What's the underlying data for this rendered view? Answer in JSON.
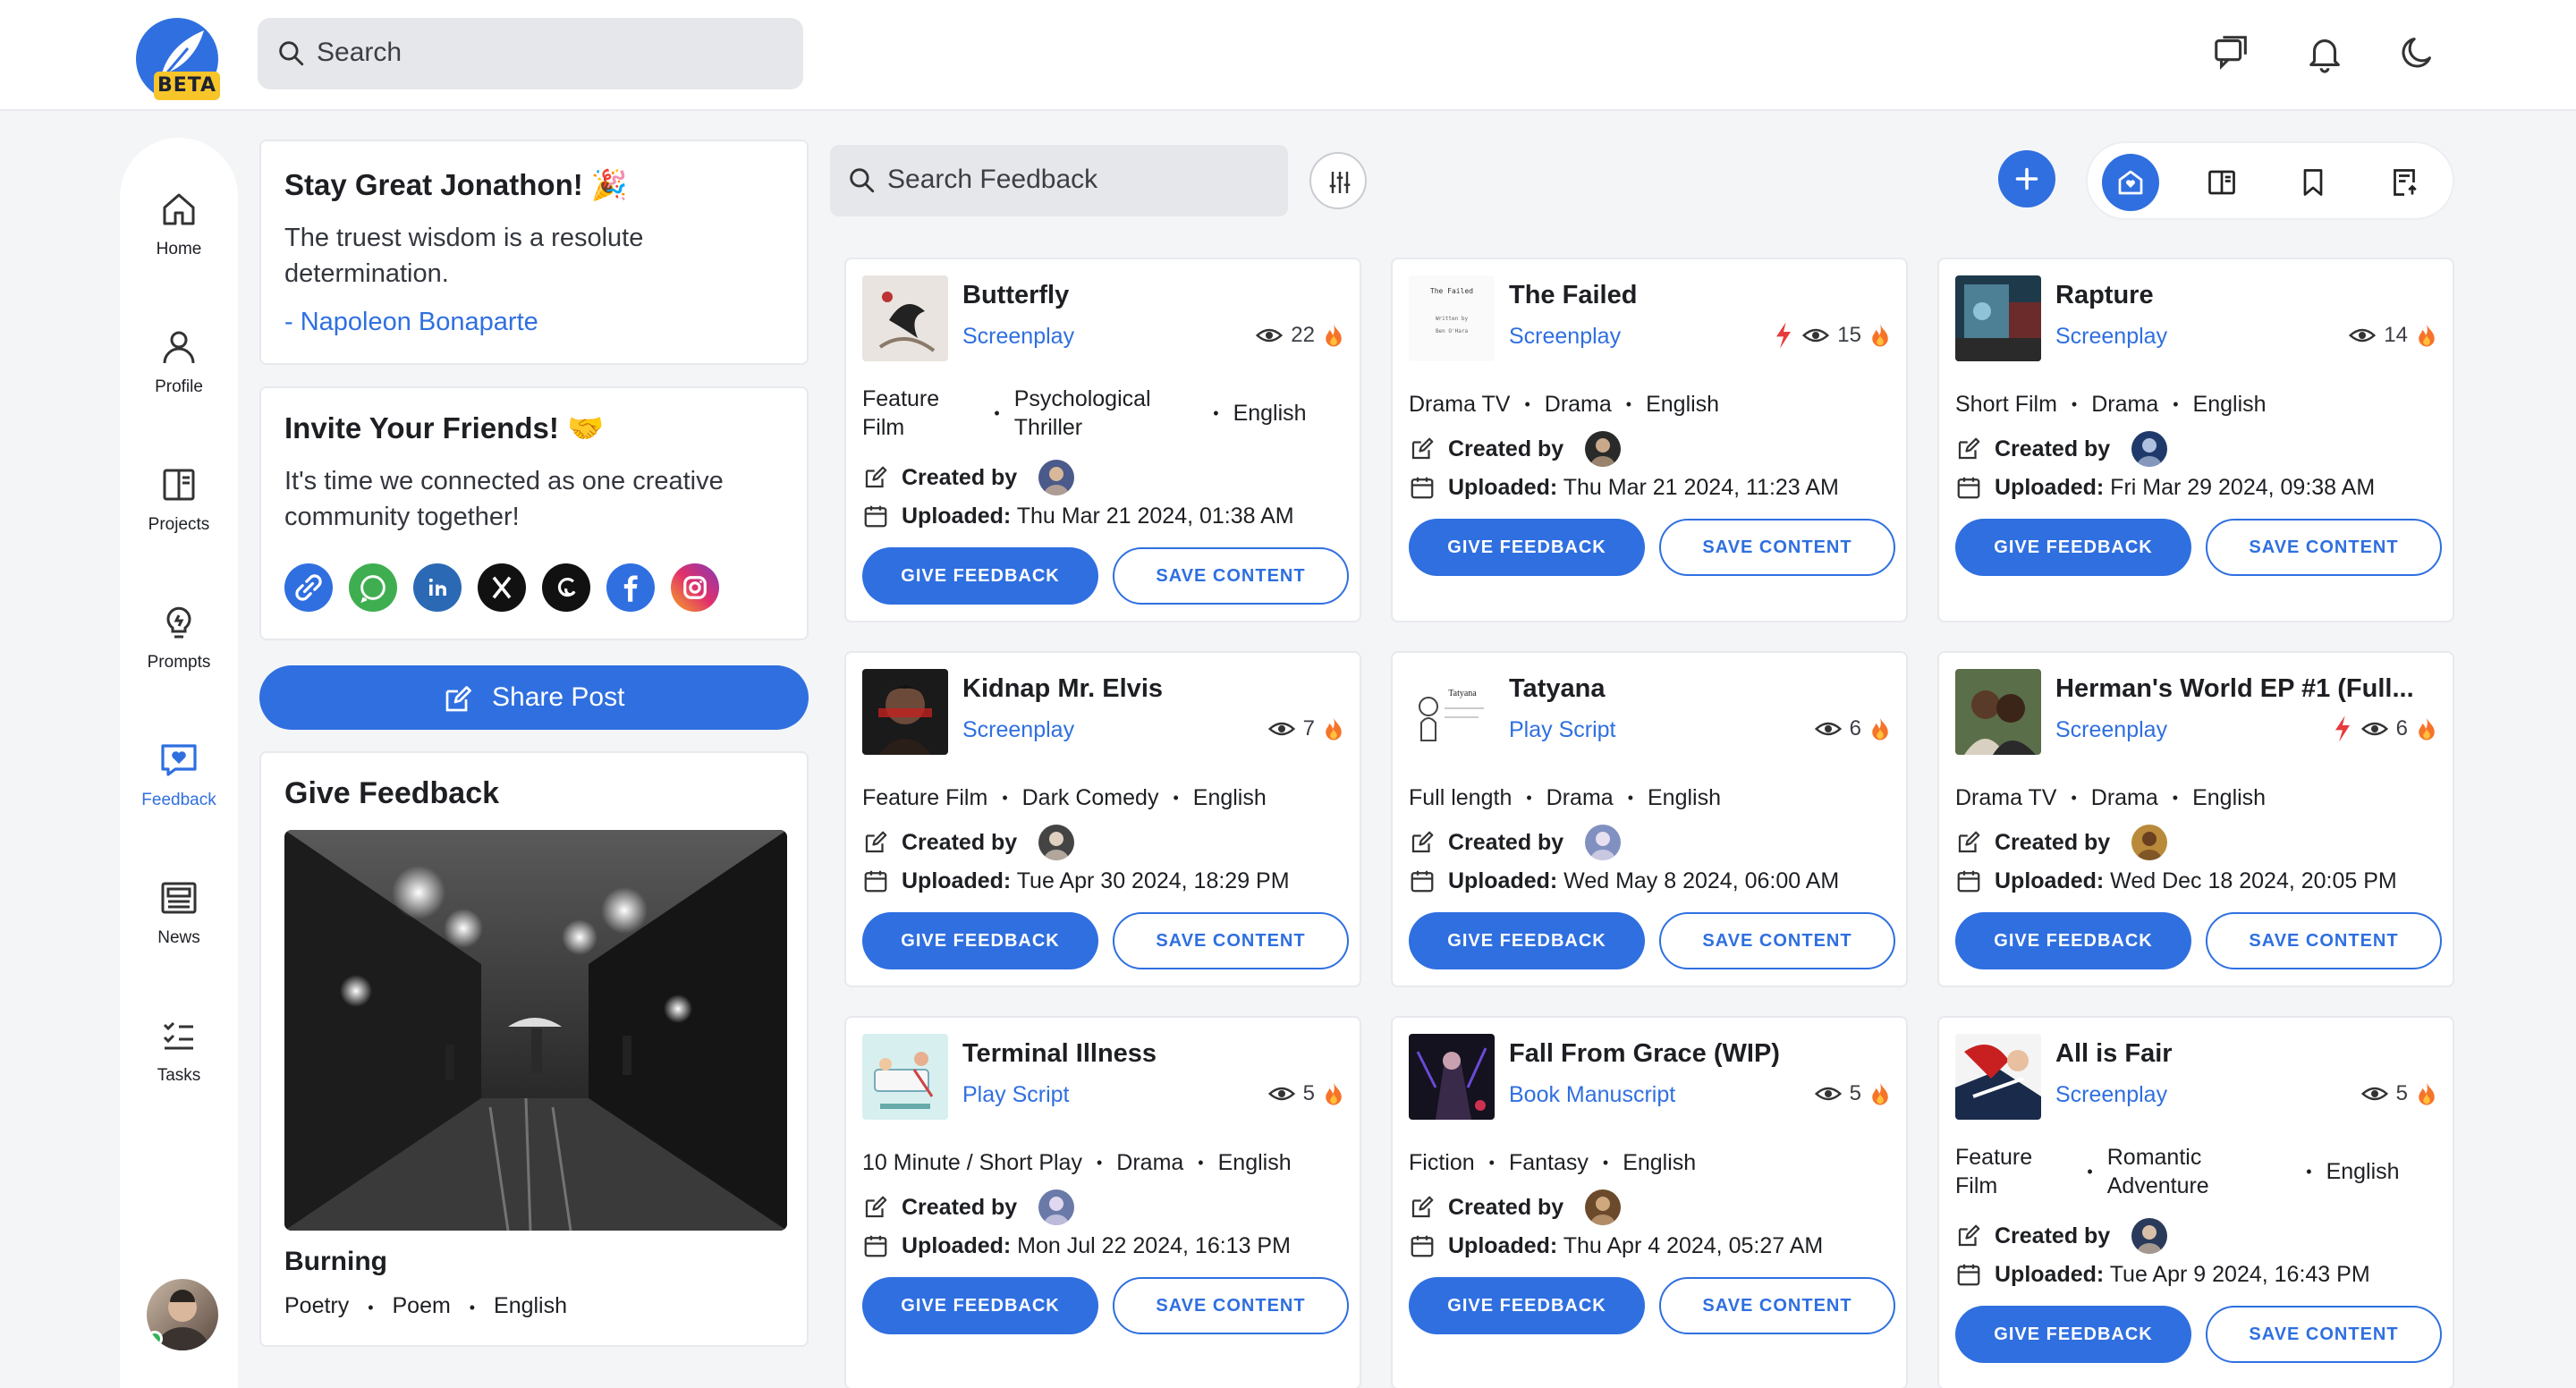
{
  "app": {
    "logo_badge": "BETA",
    "accent": "#2f6fe0"
  },
  "topbar": {
    "search_placeholder": "Search"
  },
  "nav": [
    {
      "label": "Home",
      "icon": "home-icon"
    },
    {
      "label": "Profile",
      "icon": "user-icon"
    },
    {
      "label": "Projects",
      "icon": "book-icon"
    },
    {
      "label": "Prompts",
      "icon": "lightbulb-icon"
    },
    {
      "label": "Feedback",
      "icon": "feedback-icon",
      "active": true
    },
    {
      "label": "News",
      "icon": "newspaper-icon"
    },
    {
      "label": "Tasks",
      "icon": "tasks-icon"
    }
  ],
  "greeting": {
    "title": "Stay Great Jonathon! 🎉",
    "quote": "The truest wisdom is a resolute determination.",
    "author": "- Napoleon Bonaparte"
  },
  "invite": {
    "title": "Invite Your Friends! 🤝",
    "text": "It's time we connected as one creative community together!",
    "socials": [
      "link",
      "whatsapp",
      "linkedin",
      "x",
      "threads",
      "facebook",
      "instagram"
    ]
  },
  "share_button": "Share Post",
  "give_feedback": {
    "title": "Give Feedback",
    "item_title": "Burning",
    "tags": [
      "Poetry",
      "Poem",
      "English"
    ]
  },
  "feedback_search": {
    "placeholder": "Search Feedback"
  },
  "labels": {
    "created_by": "Created by",
    "uploaded": "Uploaded:",
    "give_feedback": "GIVE FEEDBACK",
    "save_content": "SAVE CONTENT"
  },
  "cards": [
    {
      "title": "Butterfly",
      "type": "Screenplay",
      "views": "22",
      "hot": false,
      "tags": [
        "Feature Film",
        "Psychological Thriller",
        "English"
      ],
      "uploaded": "Thu Mar 21 2024, 01:38 AM"
    },
    {
      "title": "The Failed",
      "type": "Screenplay",
      "views": "15",
      "hot": true,
      "tags": [
        "Drama TV",
        "Drama",
        "English"
      ],
      "uploaded": "Thu Mar 21 2024, 11:23 AM",
      "thumb_lines": [
        "The Failed",
        "Written by",
        "Ben O'Hara"
      ]
    },
    {
      "title": "Rapture",
      "type": "Screenplay",
      "views": "14",
      "hot": false,
      "tags": [
        "Short Film",
        "Drama",
        "English"
      ],
      "uploaded": "Fri Mar 29 2024, 09:38 AM"
    },
    {
      "title": "Kidnap Mr. Elvis",
      "type": "Screenplay",
      "views": "7",
      "hot": false,
      "tags": [
        "Feature Film",
        "Dark Comedy",
        "English"
      ],
      "uploaded": "Tue Apr 30 2024, 18:29 PM"
    },
    {
      "title": "Tatyana",
      "type": "Play Script",
      "views": "6",
      "hot": false,
      "tags": [
        "Full length",
        "Drama",
        "English"
      ],
      "uploaded": "Wed May 8 2024, 06:00 AM",
      "thumb_lines": [
        "Tatyana"
      ]
    },
    {
      "title": "Herman's World EP #1 (Full...",
      "type": "Screenplay",
      "views": "6",
      "hot": true,
      "tags": [
        "Drama TV",
        "Drama",
        "English"
      ],
      "uploaded": "Wed Dec 18 2024, 20:05 PM"
    },
    {
      "title": "Terminal Illness",
      "type": "Play Script",
      "views": "5",
      "hot": false,
      "tags": [
        "10 Minute / Short Play",
        "Drama",
        "English"
      ],
      "uploaded": "Mon Jul 22 2024, 16:13 PM"
    },
    {
      "title": "Fall From Grace (WIP)",
      "type": "Book Manuscript",
      "views": "5",
      "hot": false,
      "tags": [
        "Fiction",
        "Fantasy",
        "English"
      ],
      "uploaded": "Thu Apr 4 2024, 05:27 AM"
    },
    {
      "title": "All is Fair",
      "type": "Screenplay",
      "views": "5",
      "hot": false,
      "tags": [
        "Feature Film",
        "Romantic Adventure",
        "English"
      ],
      "uploaded": "Tue Apr 9 2024, 16:43 PM"
    }
  ]
}
